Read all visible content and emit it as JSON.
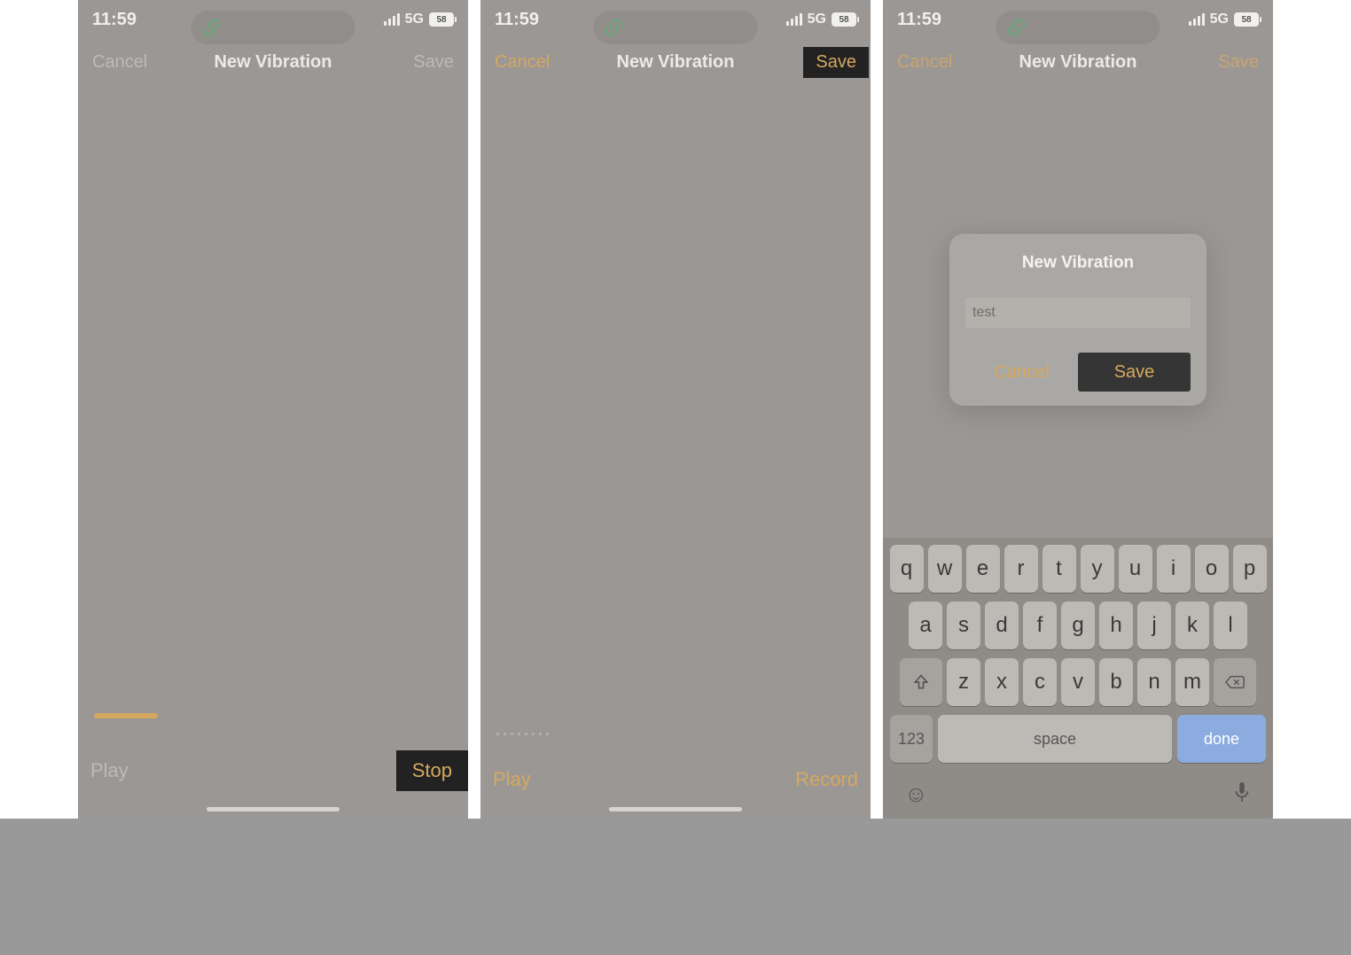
{
  "status": {
    "time": "11:59",
    "network": "5G",
    "battery": "58"
  },
  "nav": {
    "cancel": "Cancel",
    "title": "New Vibration",
    "save": "Save"
  },
  "controls": {
    "play": "Play",
    "stop": "Stop",
    "record": "Record"
  },
  "dialog": {
    "title": "New Vibration",
    "input_value": "test",
    "cancel": "Cancel",
    "save": "Save"
  },
  "keyboard": {
    "row1": [
      "q",
      "w",
      "e",
      "r",
      "t",
      "y",
      "u",
      "i",
      "o",
      "p"
    ],
    "row2": [
      "a",
      "s",
      "d",
      "f",
      "g",
      "h",
      "j",
      "k",
      "l"
    ],
    "row3": [
      "z",
      "x",
      "c",
      "v",
      "b",
      "n",
      "m"
    ],
    "num": "123",
    "space": "space",
    "done": "done"
  }
}
